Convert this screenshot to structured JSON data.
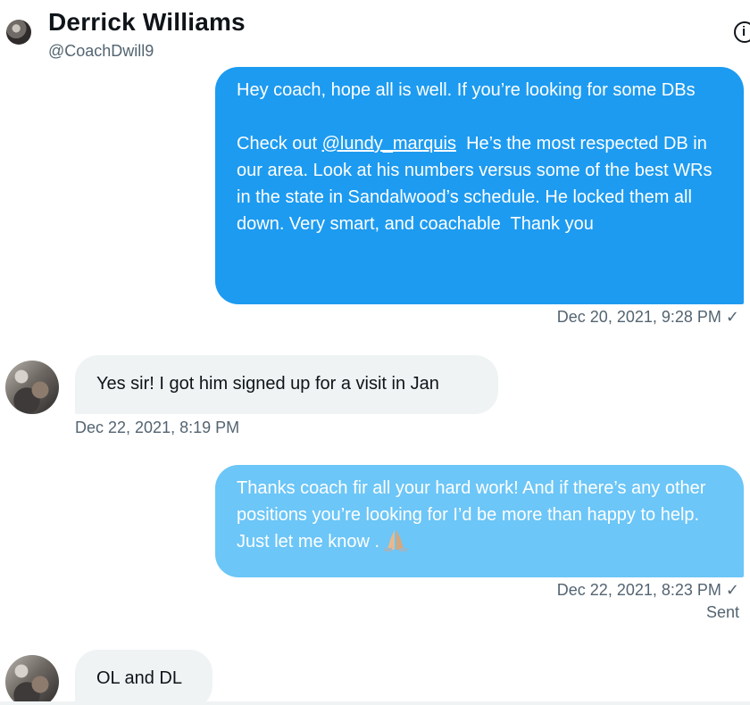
{
  "header": {
    "name": "Derrick Williams",
    "handle": "@CoachDwill9",
    "info_icon": "info-icon"
  },
  "messages": [
    {
      "direction": "sent",
      "text_before_mention": "Hey coach, hope all is well. If you’re looking for some DBs\n\nCheck out ",
      "mention": "@lundy_marquis",
      "text_after_mention": "  He’s the most respected DB in our area. Look at his numbers versus some of the best WRs in the state in Sandalwood’s schedule. He locked them all down. Very smart, and coachable  Thank you",
      "timestamp": "Dec 20, 2021, 9:28 PM"
    },
    {
      "direction": "received",
      "text": "Yes sir! I got him signed up for a visit in Jan",
      "timestamp": "Dec 22, 2021, 8:19 PM"
    },
    {
      "direction": "sent",
      "text": "Thanks coach fir all your hard work! And if there’s any other positions you’re looking for I’d be more than happy to help. Just let me know .",
      "emoji": "folded-hands",
      "timestamp": "Dec 22, 2021, 8:23 PM",
      "status": "Sent"
    },
    {
      "direction": "received",
      "text": "OL and DL"
    }
  ],
  "colors": {
    "sent_bubble": "#1d9bf0",
    "sent_bubble_pending": "#6cc6f7",
    "received_bubble": "#eff3f4",
    "secondary_text": "#536471"
  }
}
